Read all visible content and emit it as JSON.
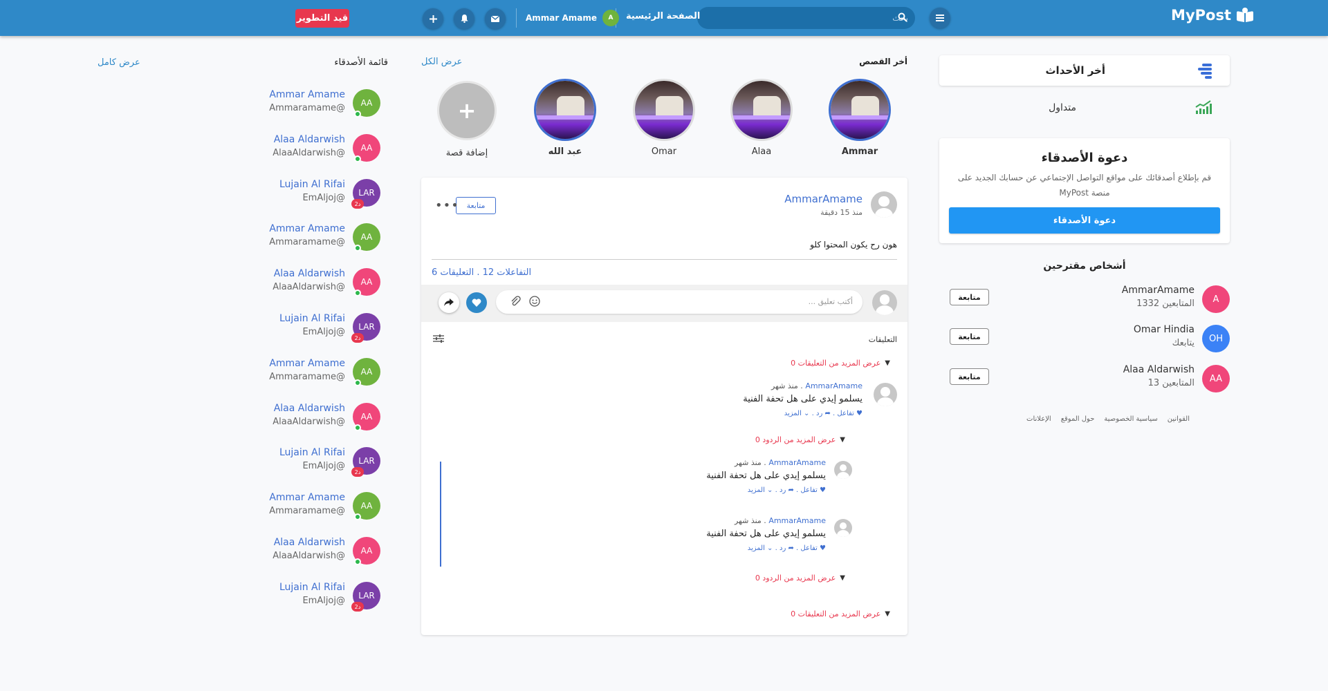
{
  "header": {
    "brand": "MyPost",
    "search_placeholder": "بحث",
    "home": "الصفحة الرئيسية",
    "user_name": "Ammar Amame",
    "user_initial": "A",
    "dev_badge": "قيد التطوير",
    "colors": {
      "bar": "#2f89c8",
      "badge": "#e8374e"
    }
  },
  "sidebar": {
    "events_title": "أخر الأحداث",
    "trending": "متداول",
    "invite": {
      "title": "دعوة الأصدقاء",
      "description": "قم بإطلاع أصدقائك على مواقع التواصل الإجتماعي عن حسابك الجديد على منصة MyPost",
      "button": "دعوة الأصدقاء"
    },
    "suggested_title": "أشخاص مقترحين",
    "suggested": [
      {
        "initials": "A",
        "name": "AmmarAmame",
        "sub": "المتابعين 1332",
        "follow": "متابعة",
        "color": "#f0467a"
      },
      {
        "initials": "OH",
        "name": "Omar Hindia",
        "sub": "يتابعك",
        "follow": "متابعة",
        "color": "#3b82f6"
      },
      {
        "initials": "AA",
        "name": "Alaa Aldarwish",
        "sub": "المتابعين 13",
        "follow": "متابعة",
        "color": "#f0467a"
      }
    ],
    "footer_links": [
      "القوانين",
      "سياسية الخصوصية",
      "حول الموقع",
      "الإعلانات"
    ]
  },
  "stories": {
    "title": "أخر القصص",
    "view_all": "عرض الكل",
    "items": [
      {
        "name": "Ammar",
        "bold": true
      },
      {
        "name": "Alaa",
        "bold": false
      },
      {
        "name": "Omar",
        "bold": false
      },
      {
        "name": "عبد الله",
        "bold": true
      }
    ],
    "add_label": "إضافة قصة"
  },
  "post": {
    "author": "AmmarAmame",
    "time": "منذ 15 دقيقة",
    "follow": "متابعة",
    "more": "•••",
    "text": "هون رح يكون المحتوا كلو",
    "stats": "التفاعلات 12 . التعليقات 6",
    "comment_placeholder": "أكتب تعليق ...",
    "comments_label": "التعليقات",
    "more_comments": "عرض المزيد من التعليقات 0",
    "more_replies": "عرض المزيد من الردود 0",
    "comment": {
      "author": "AmmarAmame",
      "when": ". منذ شهر",
      "text": "يسلمو إيدي على هل تحفة الفنية",
      "like": "تفاعل",
      "reply": "رد",
      "more": "المزيد"
    }
  },
  "friends": {
    "title": "قائمة الأصدقاء",
    "view_full": "عرض كامل",
    "items": [
      {
        "initials": "AA",
        "name": "Ammar Amame",
        "handle": "Ammaramame@",
        "color": "#6fb33e",
        "status": "online"
      },
      {
        "initials": "AA",
        "name": "Alaa Aldarwish",
        "handle": "AlaaAldarwish@",
        "color": "#f0467a",
        "status": "online"
      },
      {
        "initials": "LAR",
        "name": "Lujain Al Rifai",
        "handle": "EmAljoj@",
        "color": "#7b3fa8",
        "status": "2د"
      },
      {
        "initials": "AA",
        "name": "Ammar Amame",
        "handle": "Ammaramame@",
        "color": "#6fb33e",
        "status": "online"
      },
      {
        "initials": "AA",
        "name": "Alaa Aldarwish",
        "handle": "AlaaAldarwish@",
        "color": "#f0467a",
        "status": "online"
      },
      {
        "initials": "LAR",
        "name": "Lujain Al Rifai",
        "handle": "EmAljoj@",
        "color": "#7b3fa8",
        "status": "2د"
      },
      {
        "initials": "AA",
        "name": "Ammar Amame",
        "handle": "Ammaramame@",
        "color": "#6fb33e",
        "status": "online"
      },
      {
        "initials": "AA",
        "name": "Alaa Aldarwish",
        "handle": "AlaaAldarwish@",
        "color": "#f0467a",
        "status": "online"
      },
      {
        "initials": "LAR",
        "name": "Lujain Al Rifai",
        "handle": "EmAljoj@",
        "color": "#7b3fa8",
        "status": "2د"
      },
      {
        "initials": "AA",
        "name": "Ammar Amame",
        "handle": "Ammaramame@",
        "color": "#6fb33e",
        "status": "online"
      },
      {
        "initials": "AA",
        "name": "Alaa Aldarwish",
        "handle": "AlaaAldarwish@",
        "color": "#f0467a",
        "status": "online"
      },
      {
        "initials": "LAR",
        "name": "Lujain Al Rifai",
        "handle": "EmAljoj@",
        "color": "#7b3fa8",
        "status": "2د"
      }
    ]
  }
}
